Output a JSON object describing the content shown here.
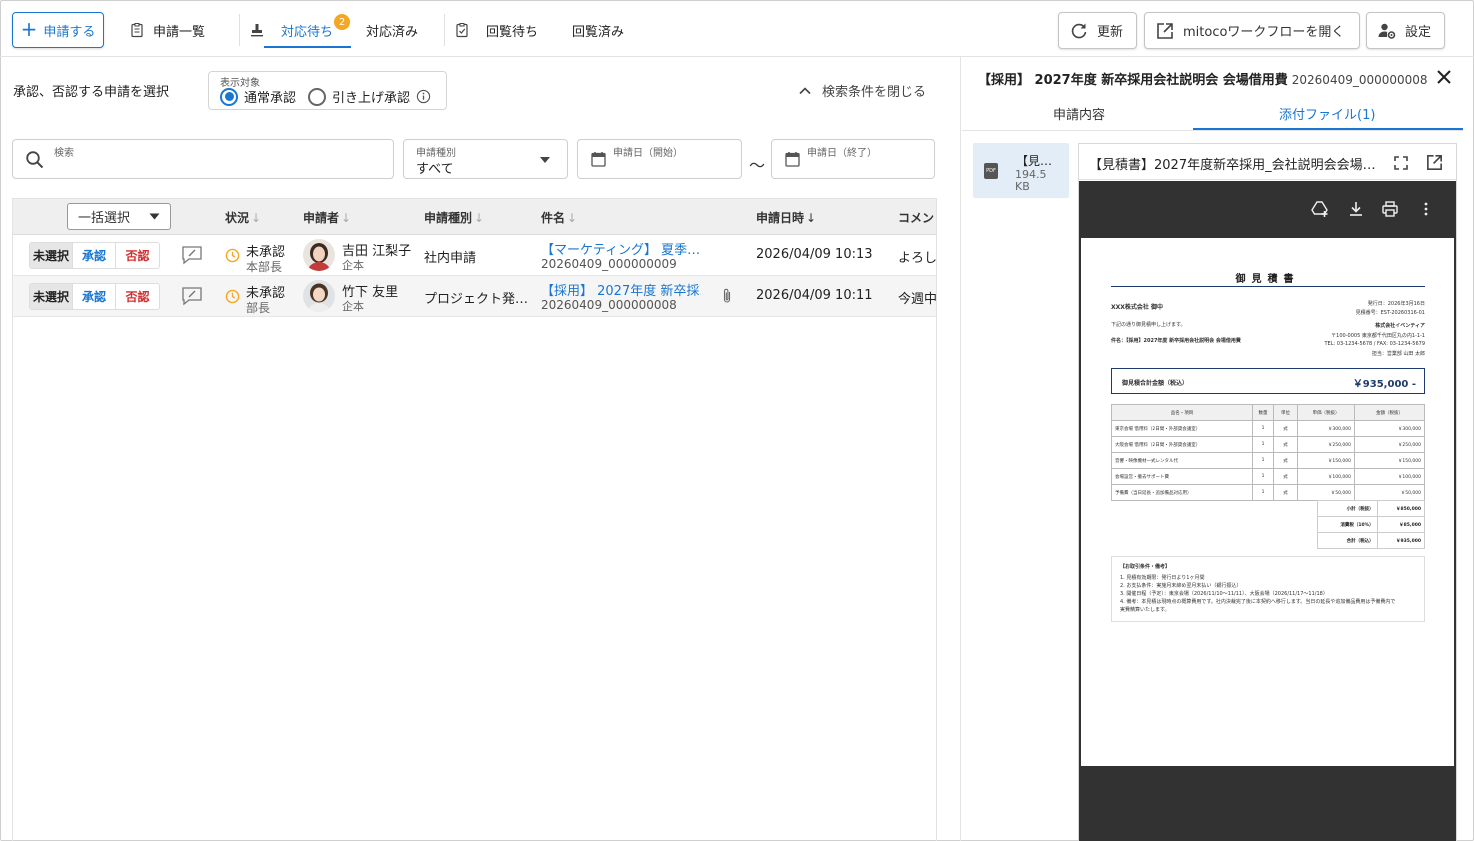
{
  "toolbar": {
    "new_label": "申請する",
    "list_label": "申請一覧",
    "pending_label": "対応待ち",
    "pending_count": "2",
    "done_label": "対応済み",
    "circ_wait_label": "回覧待ち",
    "circ_done_label": "回覧済み",
    "refresh_label": "更新",
    "open_workflow_label": "mitocoワークフローを開く",
    "settings_label": "設定"
  },
  "filter": {
    "prompt": "承認、否認する申請を選択",
    "legend": "表示対象",
    "option_normal": "通常承認",
    "option_pullup": "引き上げ承認",
    "close_label": "検索条件を閉じる",
    "search_label": "検索",
    "type_label": "申請種別",
    "type_value": "すべて",
    "date_from_label": "申請日（開始）",
    "date_to_label": "申請日（終了）",
    "tilde": "～"
  },
  "table": {
    "bulk_label": "一括選択",
    "headers": {
      "status": "状況",
      "applicant": "申請者",
      "type": "申請種別",
      "subject": "件名",
      "datetime": "申請日時",
      "comment": "コメン"
    },
    "seg": {
      "none": "未選択",
      "approve": "承認",
      "reject": "否認"
    },
    "rows": [
      {
        "status": "未承認",
        "approver": "本部長",
        "name": "吉田 江梨子",
        "dept": "企本",
        "type": "社内申請",
        "subject": "【マーケティング】 夏季…",
        "number": "20260409_000000009",
        "datetime": "2026/04/09 10:13",
        "comment": "よろし"
      },
      {
        "status": "未承認",
        "approver": "部長",
        "name": "竹下 友里",
        "dept": "企本",
        "type": "プロジェクト発…",
        "subject": "【採用】 2027年度 新卒採…",
        "number": "20260409_000000008",
        "datetime": "2026/04/09 10:11",
        "comment": "今週中"
      }
    ]
  },
  "panel": {
    "title": "【採用】 2027年度 新卒採用会社説明会 会場借用費",
    "number": "20260409_000000008",
    "tab_content": "申請内容",
    "tab_files": "添付ファイル(1)",
    "file_short": "【見…",
    "file_size_1": "194.5",
    "file_size_2": "KB",
    "pdf_tag": "PDF",
    "viewer_title": "【見積書】2027年度新卒採用_会社説明会会場…"
  },
  "doc": {
    "title": "御見積書",
    "to": "XXX株式会社 御中",
    "issue_date": "発行日：2026年3月16日",
    "quote_no": "見積番号：EST-20260316-01",
    "intro": "下記の通り御見積申し上げます。",
    "subject": "件名：【採用】2027年度 新卒採用会社説明会 会場借用費",
    "company": "株式会社イベンティア",
    "address": "〒100-0005 東京都千代田区丸の内1-1-1",
    "tel": "TEL: 03-1234-5678 / FAX: 03-1234-5679",
    "staff": "担当：営業部 山田 太郎",
    "total_label": "御見積合計金額（税込）",
    "total_value": "￥935,000 -",
    "col_item": "品名・項目",
    "col_qty": "数量",
    "col_unit": "単位",
    "col_price": "単価（税抜）",
    "col_amount": "金額（税抜）",
    "items": [
      {
        "name": "東京会場 借用料（2日間・外部貸会議室）",
        "qty": "1",
        "unit": "式",
        "price": "￥300,000",
        "amount": "￥300,000"
      },
      {
        "name": "大阪会場 借用料（2日間・外部貸会議室）",
        "qty": "1",
        "unit": "式",
        "price": "￥250,000",
        "amount": "￥250,000"
      },
      {
        "name": "音響・映像機材一式レンタル代",
        "qty": "1",
        "unit": "式",
        "price": "￥150,000",
        "amount": "￥150,000"
      },
      {
        "name": "会場設営・撤去サポート費",
        "qty": "1",
        "unit": "式",
        "price": "￥100,000",
        "amount": "￥100,000"
      },
      {
        "name": "予備費（当日延長・追加備品対応用）",
        "qty": "1",
        "unit": "式",
        "price": "￥50,000",
        "amount": "￥50,000"
      }
    ],
    "subtotal_label": "小計（税抜）",
    "subtotal": "￥850,000",
    "tax_label": "消費税（10%）",
    "tax": "￥85,000",
    "grand_label": "合計（税込）",
    "grand": "￥935,000",
    "notes_title": "【お取引条件・備考】",
    "notes": [
      "1. 見積有効期限：発行日より1ヶ月間",
      "2. お支払条件：実施月末締め翌月末払い（銀行振込）",
      "3. 開催日程（予定）：東京会場（2026/11/10〜11/11）、大阪会場（2026/11/17〜11/18）",
      "4. 備考：本見積は現時点の概算費用です。社内決裁完了後に本契約へ移行します。当日の延長や追加備品費用は予備費内で",
      "   実費精算いたします。"
    ]
  },
  "colors": {
    "accent": "#1976d2",
    "reject": "#d32f2f",
    "badge": "#f5a623"
  }
}
